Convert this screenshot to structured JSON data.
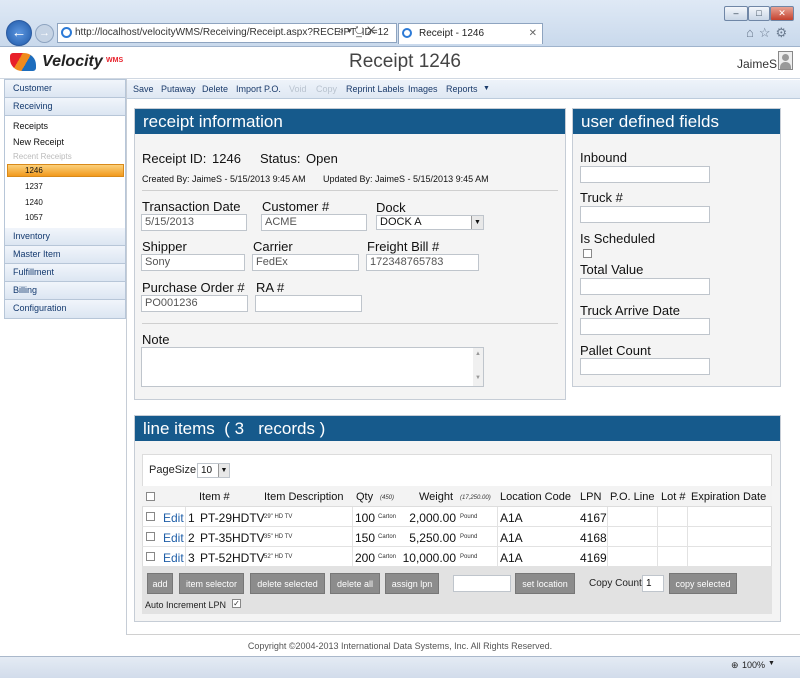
{
  "browser": {
    "address": "http://localhost/velocityWMS/Receiving/Receipt.aspx?RECEIPT_ID=12",
    "tab_title": "Receipt - 1246",
    "back_icon": "back-arrow-icon",
    "forward_icon": "forward-arrow-icon"
  },
  "header": {
    "logo": "Velocity",
    "logo_sub": "WMS",
    "title": "Receipt 1246",
    "user": "JaimeS"
  },
  "sidebar": {
    "sections": [
      "Customer",
      "Receiving",
      "Inventory",
      "Master Item",
      "Fulfillment",
      "Billing",
      "Configuration"
    ],
    "receiving_links": [
      "Receipts",
      "New Receipt"
    ],
    "recent_label": "Recent Receipts",
    "recent": [
      "1246",
      "1237",
      "1240",
      "1057"
    ]
  },
  "toolbar": {
    "items": [
      "Save",
      "Putaway",
      "Delete",
      "Import P.O.",
      "Void",
      "Copy",
      "Reprint Labels",
      "Images",
      "Reports"
    ]
  },
  "receipt": {
    "heading": "receipt information",
    "id_label": "Receipt ID:",
    "id_value": "1246",
    "status_label": "Status:",
    "status_value": "Open",
    "created": "Created By: JaimeS - 5/15/2013 9:45 AM",
    "updated": "Updated By: JaimeS - 5/15/2013 9:45 AM",
    "transaction_date_label": "Transaction Date",
    "transaction_date": "5/15/2013",
    "customer_label": "Customer #",
    "customer": "ACME",
    "dock_label": "Dock",
    "dock": "DOCK A",
    "shipper_label": "Shipper",
    "shipper": "Sony",
    "carrier_label": "Carrier",
    "carrier": "FedEx",
    "freight_label": "Freight Bill #",
    "freight": "172348765783",
    "po_label": "Purchase Order #",
    "po": "PO001236",
    "ra_label": "RA #",
    "ra": "",
    "note_label": "Note",
    "note": ""
  },
  "udf": {
    "heading": "user defined fields",
    "inbound": "Inbound",
    "truck": "Truck #",
    "scheduled": "Is Scheduled",
    "total_value": "Total Value",
    "arrive": "Truck Arrive Date",
    "pallet": "Pallet Count"
  },
  "lines": {
    "heading": "line items  ( 3   records )",
    "pagesize_label": "PageSize",
    "pagesize": "10",
    "columns": [
      "Item #",
      "Item Description",
      "Qty",
      "Weight",
      "Location Code",
      "LPN",
      "P.O. Line",
      "Lot #",
      "Expiration Date"
    ],
    "qty_total": "(450)",
    "weight_total": "(17,250.00)",
    "rows": [
      {
        "edit": "Edit",
        "n": "1",
        "item": "PT-29HDTV",
        "desc": "29\" HD TV",
        "qty": "100",
        "unit": "Carton",
        "weight": "2,000.00",
        "wunit": "Pound",
        "loc": "A1A",
        "lpn": "4167"
      },
      {
        "edit": "Edit",
        "n": "2",
        "item": "PT-35HDTV",
        "desc": "35\" HD TV",
        "qty": "150",
        "unit": "Carton",
        "weight": "5,250.00",
        "wunit": "Pound",
        "loc": "A1A",
        "lpn": "4168"
      },
      {
        "edit": "Edit",
        "n": "3",
        "item": "PT-52HDTV",
        "desc": "52\" HD TV",
        "qty": "200",
        "unit": "Carton",
        "weight": "10,000.00",
        "wunit": "Pound",
        "loc": "A1A",
        "lpn": "4169"
      }
    ],
    "buttons": [
      "add",
      "item selector",
      "delete selected",
      "delete all",
      "assign lpn",
      "set location",
      "copy selected"
    ],
    "copy_count_label": "Copy Count:",
    "copy_count": "1",
    "auto_lpn": "Auto Increment LPN"
  },
  "footer": "Copyright ©2004-2013 International Data Systems, Inc. All Rights Reserved.",
  "status": {
    "zoom": "100%"
  }
}
